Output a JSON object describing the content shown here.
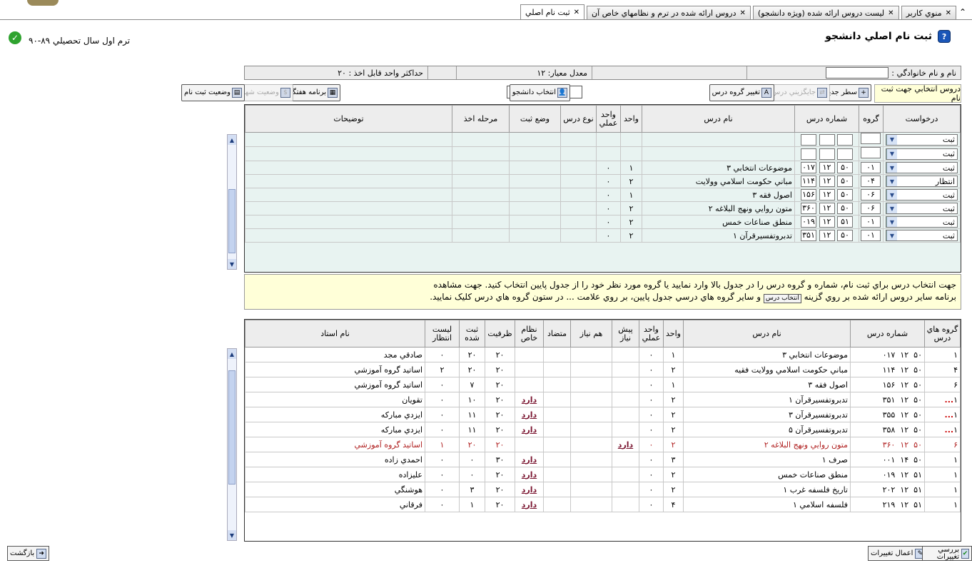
{
  "tabs": [
    {
      "label": "منوي کاربر",
      "active": false
    },
    {
      "label": "ليست دروس ارائه شده (ويژه دانشجو)",
      "active": false
    },
    {
      "label": "دروس ارائه شده در ترم و نظامهاي خاص آن",
      "active": false
    },
    {
      "label": "ثبت نام اصلي",
      "active": true
    }
  ],
  "header": {
    "title": "ثبت نام اصلي دانشجو",
    "term": "ترم اول سال تحصيلي ۸۹-۹۰"
  },
  "info": {
    "name_label": "نام و نام خانوادگي :",
    "gpa": "معدل معيار: ۱۲",
    "max_units": "حداکثر واحد قابل اخذ : ۲۰"
  },
  "toolbar": {
    "selected_label": "دروس انتخابي جهت ثبت نام",
    "new_row": "سطر جديد",
    "substitute": "جايگزيني درس",
    "change_group": "تغيير گروه درس",
    "select_student": "انتخاب دانشجو",
    "weekly_program": "برنامه هفتگي",
    "tuition_status": "وضعيت شهريه",
    "registration_status": "وضعيت ثبت نام"
  },
  "upper_table": {
    "headers": [
      "درخواست",
      "گروه",
      "شماره درس",
      "نام درس",
      "واحد",
      "واحد عملي",
      "نوع درس",
      "وضع ثبت",
      "مرحله اخذ",
      "توضيحات"
    ],
    "rows": [
      {
        "request": "ثبت",
        "group": "",
        "code": [
          "",
          "",
          ""
        ],
        "name": "",
        "units": "",
        "practical": ""
      },
      {
        "request": "ثبت",
        "group": "",
        "code": [
          "",
          "",
          ""
        ],
        "name": "",
        "units": "",
        "practical": ""
      },
      {
        "request": "ثبت",
        "group": "۰۱",
        "code": [
          "۵۰",
          "۱۲",
          "۰۱۷"
        ],
        "name": "موضوعات انتخابي ۳",
        "units": "۱",
        "practical": "۰"
      },
      {
        "request": "انتظار",
        "group": "۰۴",
        "code": [
          "۵۰",
          "۱۲",
          "۱۱۴"
        ],
        "name": "مباني حکومت اسلامي وولايت",
        "units": "۲",
        "practical": "۰"
      },
      {
        "request": "ثبت",
        "group": "۰۶",
        "code": [
          "۵۰",
          "۱۲",
          "۱۵۶"
        ],
        "name": "اصول فقه ۳",
        "units": "۱",
        "practical": "۰"
      },
      {
        "request": "ثبت",
        "group": "۰۶",
        "code": [
          "۵۰",
          "۱۲",
          "۳۶۰"
        ],
        "name": "متون روايي ونهج البلاغه ۲",
        "units": "۲",
        "practical": "۰"
      },
      {
        "request": "ثبت",
        "group": "۰۱",
        "code": [
          "۵۱",
          "۱۲",
          "۰۱۹"
        ],
        "name": "منطق صناعات خمس",
        "units": "۲",
        "practical": "۰"
      },
      {
        "request": "ثبت",
        "group": "۰۱",
        "code": [
          "۵۰",
          "۱۲",
          "۳۵۱"
        ],
        "name": "تدبروتفسيرقرآن ۱",
        "units": "۲",
        "practical": "۰"
      }
    ]
  },
  "notice": {
    "line1": "جهت انتخاب درس براي ثبت نام، شماره و گروه درس را در جدول بالا وارد نماييد يا گروه مورد نظر خود را از جدول پايين انتخاب کنيد. جهت مشاهده",
    "line2a": "برنامه ساير دروس ارائه شده بر روي گزينه",
    "btn": "انتخاب درس",
    "line2b": "و ساير گروه هاي درسي جدول پايين، بر روي علامت ... در ستون گروه هاي درس کليک نماييد."
  },
  "lower_table": {
    "headers": [
      "گروه هاي درس",
      "شماره درس",
      "نام درس",
      "واحد",
      "واحد عملي",
      "پيش نياز",
      "هم نياز",
      "متضاد",
      "نظام خاص",
      "ظرفيت",
      "ثبت شده",
      "ليست انتظار",
      "نام استاد"
    ],
    "rows": [
      {
        "groups": "۱",
        "code": [
          "۵۰",
          "۱۲",
          "۰۱۷"
        ],
        "name": "موضوعات انتخابي ۳",
        "units": "۱",
        "practical": "۰",
        "prereq": "",
        "special": "",
        "capacity": "۲۰",
        "registered": "۲۰",
        "waiting": "۰",
        "teacher": "صادقي مجد",
        "highlight": false,
        "more": false
      },
      {
        "groups": "۴",
        "code": [
          "۵۰",
          "۱۲",
          "۱۱۴"
        ],
        "name": "مباني حکومت اسلامي وولايت فقيه",
        "units": "۲",
        "practical": "۰",
        "prereq": "",
        "special": "",
        "capacity": "۲۰",
        "registered": "۲۰",
        "waiting": "۲",
        "teacher": "اساتيد گروه آموزشي",
        "highlight": false,
        "more": false
      },
      {
        "groups": "۶",
        "code": [
          "۵۰",
          "۱۲",
          "۱۵۶"
        ],
        "name": "اصول فقه ۳",
        "units": "۱",
        "practical": "۰",
        "prereq": "",
        "special": "",
        "capacity": "۲۰",
        "registered": "۷",
        "waiting": "۰",
        "teacher": "اساتيد گروه آموزشي",
        "highlight": false,
        "more": false
      },
      {
        "groups": "۱",
        "code": [
          "۵۰",
          "۱۲",
          "۳۵۱"
        ],
        "name": "تدبروتفسيرقرآن ۱",
        "units": "۲",
        "practical": "۰",
        "prereq": "",
        "special": "دارد",
        "capacity": "۲۰",
        "registered": "۱۰",
        "waiting": "۰",
        "teacher": "تقويان",
        "highlight": false,
        "more": true
      },
      {
        "groups": "۱",
        "code": [
          "۵۰",
          "۱۲",
          "۳۵۵"
        ],
        "name": "تدبروتفسيرقرآن ۳",
        "units": "۲",
        "practical": "۰",
        "prereq": "",
        "special": "دارد",
        "capacity": "۲۰",
        "registered": "۱۱",
        "waiting": "۰",
        "teacher": "ايزدي مبارکه",
        "highlight": false,
        "more": true
      },
      {
        "groups": "۱",
        "code": [
          "۵۰",
          "۱۲",
          "۳۵۸"
        ],
        "name": "تدبروتفسيرقرآن ۵",
        "units": "۲",
        "practical": "۰",
        "prereq": "",
        "special": "دارد",
        "capacity": "۲۰",
        "registered": "۱۱",
        "waiting": "۰",
        "teacher": "ايزدي مبارکه",
        "highlight": false,
        "more": true
      },
      {
        "groups": "۶",
        "code": [
          "۵۰",
          "۱۲",
          "۳۶۰"
        ],
        "name": "متون روايي ونهج البلاغه ۲",
        "units": "۲",
        "practical": "۰",
        "prereq": "دارد",
        "special": "",
        "capacity": "۲۰",
        "registered": "۲۰",
        "waiting": "۱",
        "teacher": "اساتيد گروه آموزشي",
        "highlight": true,
        "more": false
      },
      {
        "groups": "۱",
        "code": [
          "۵۰",
          "۱۴",
          "۰۰۱"
        ],
        "name": "صرف ۱",
        "units": "۳",
        "practical": "۰",
        "prereq": "",
        "special": "دارد",
        "capacity": "۳۰",
        "registered": "۰",
        "waiting": "۰",
        "teacher": "احمدي زاده",
        "highlight": false,
        "more": false
      },
      {
        "groups": "۱",
        "code": [
          "۵۱",
          "۱۲",
          "۰۱۹"
        ],
        "name": "منطق صناعات خمس",
        "units": "۲",
        "practical": "۰",
        "prereq": "",
        "special": "دارد",
        "capacity": "۲۰",
        "registered": "۰",
        "waiting": "۰",
        "teacher": "عليزاده",
        "highlight": false,
        "more": false
      },
      {
        "groups": "۱",
        "code": [
          "۵۱",
          "۱۲",
          "۲۰۲"
        ],
        "name": "تاريخ فلسفه غرب ۱",
        "units": "۲",
        "practical": "۰",
        "prereq": "",
        "special": "دارد",
        "capacity": "۲۰",
        "registered": "۳",
        "waiting": "۰",
        "teacher": "هوشنگي",
        "highlight": false,
        "more": false
      },
      {
        "groups": "۱",
        "code": [
          "۵۱",
          "۱۲",
          "۲۱۹"
        ],
        "name": "فلسفه اسلامي ۱",
        "units": "۴",
        "practical": "۰",
        "prereq": "",
        "special": "دارد",
        "capacity": "۲۰",
        "registered": "۱",
        "waiting": "۰",
        "teacher": "فرقاني",
        "highlight": false,
        "more": false
      }
    ]
  },
  "footer": {
    "back": "بازگشت",
    "review": "بررسي تغييرات",
    "apply": "اعمال تغييرات"
  }
}
